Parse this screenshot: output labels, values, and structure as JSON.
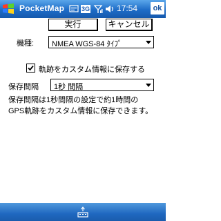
{
  "titlebar": {
    "app_title": "PocketMap",
    "network_badge": "3G",
    "clock": "17:54",
    "ok_label": "ok"
  },
  "toolbar": {
    "run_label": "実行",
    "cancel_label": "キャンセル"
  },
  "form": {
    "model_label": "機種:",
    "model_value": "NMEA WGS-84 ﾀｲﾌﾟ",
    "save_checkbox_label": "軌跡をカスタム情報に保存する",
    "save_checked": true,
    "interval_label": "保存間隔",
    "interval_value": "1秒 間隔",
    "description_line1": "保存間隔は1秒間隔の設定で約1時間の",
    "description_line2": "GPS軌跡をカスタム情報に保存できます。"
  },
  "icons": {
    "start": "windows-flag-icon",
    "caption": "caption-icon",
    "signal": "signal-icon",
    "volume": "volume-icon",
    "keyboard": "keyboard-icon"
  },
  "colors": {
    "titlebar": "#1e6cc7",
    "bottombar": "#1f68c0"
  }
}
